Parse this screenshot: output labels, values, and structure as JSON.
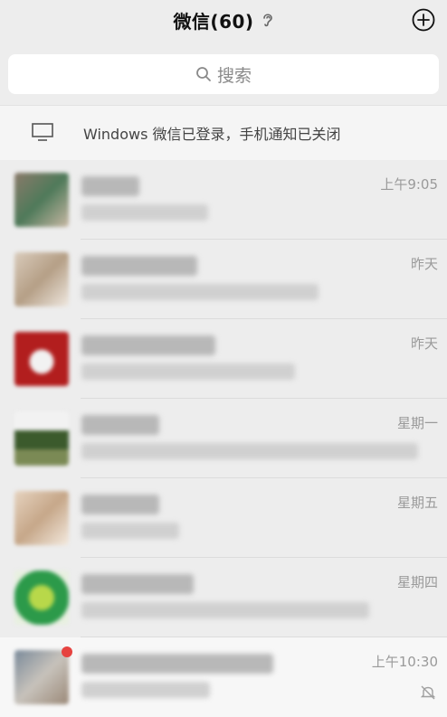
{
  "header": {
    "title": "微信(60)",
    "icons": [
      "ear-icon",
      "plus-circle-icon"
    ]
  },
  "search": {
    "placeholder": "搜索",
    "icon": "search-icon"
  },
  "banner": {
    "text": "Windows 微信已登录，手机通知已关闭",
    "icon": "monitor-icon"
  },
  "chats": [
    {
      "time": "上午9:05",
      "avatar_colors": [
        "#8a7a6a",
        "#4f7a5a",
        "#c9b8a4"
      ]
    },
    {
      "time": "昨天",
      "avatar_colors": [
        "#d9cbbb",
        "#b59f86",
        "#efe8e0"
      ]
    },
    {
      "time": "昨天",
      "avatar_colors": [
        "#b21e1e",
        "#ffffff",
        "#c73b3b"
      ]
    },
    {
      "time": "星期一",
      "avatar_colors": [
        "#3b5a2c",
        "#7b8a55",
        "#f2f2f2"
      ]
    },
    {
      "time": "星期五",
      "avatar_colors": [
        "#e6d3bf",
        "#c6a789",
        "#f4eadf"
      ]
    },
    {
      "time": "星期四",
      "avatar_colors": [
        "#2c9a4a",
        "#b8d84a",
        "#e8f0e0"
      ]
    },
    {
      "time": "上午10:30",
      "avatar_colors": [
        "#7a8a9a",
        "#c7c2bb",
        "#9b8978"
      ],
      "muted": true,
      "unread_dot": true
    }
  ],
  "colors": {
    "background": "#ededed",
    "muted_text": "#9a9a9a",
    "badge": "#e64340"
  }
}
